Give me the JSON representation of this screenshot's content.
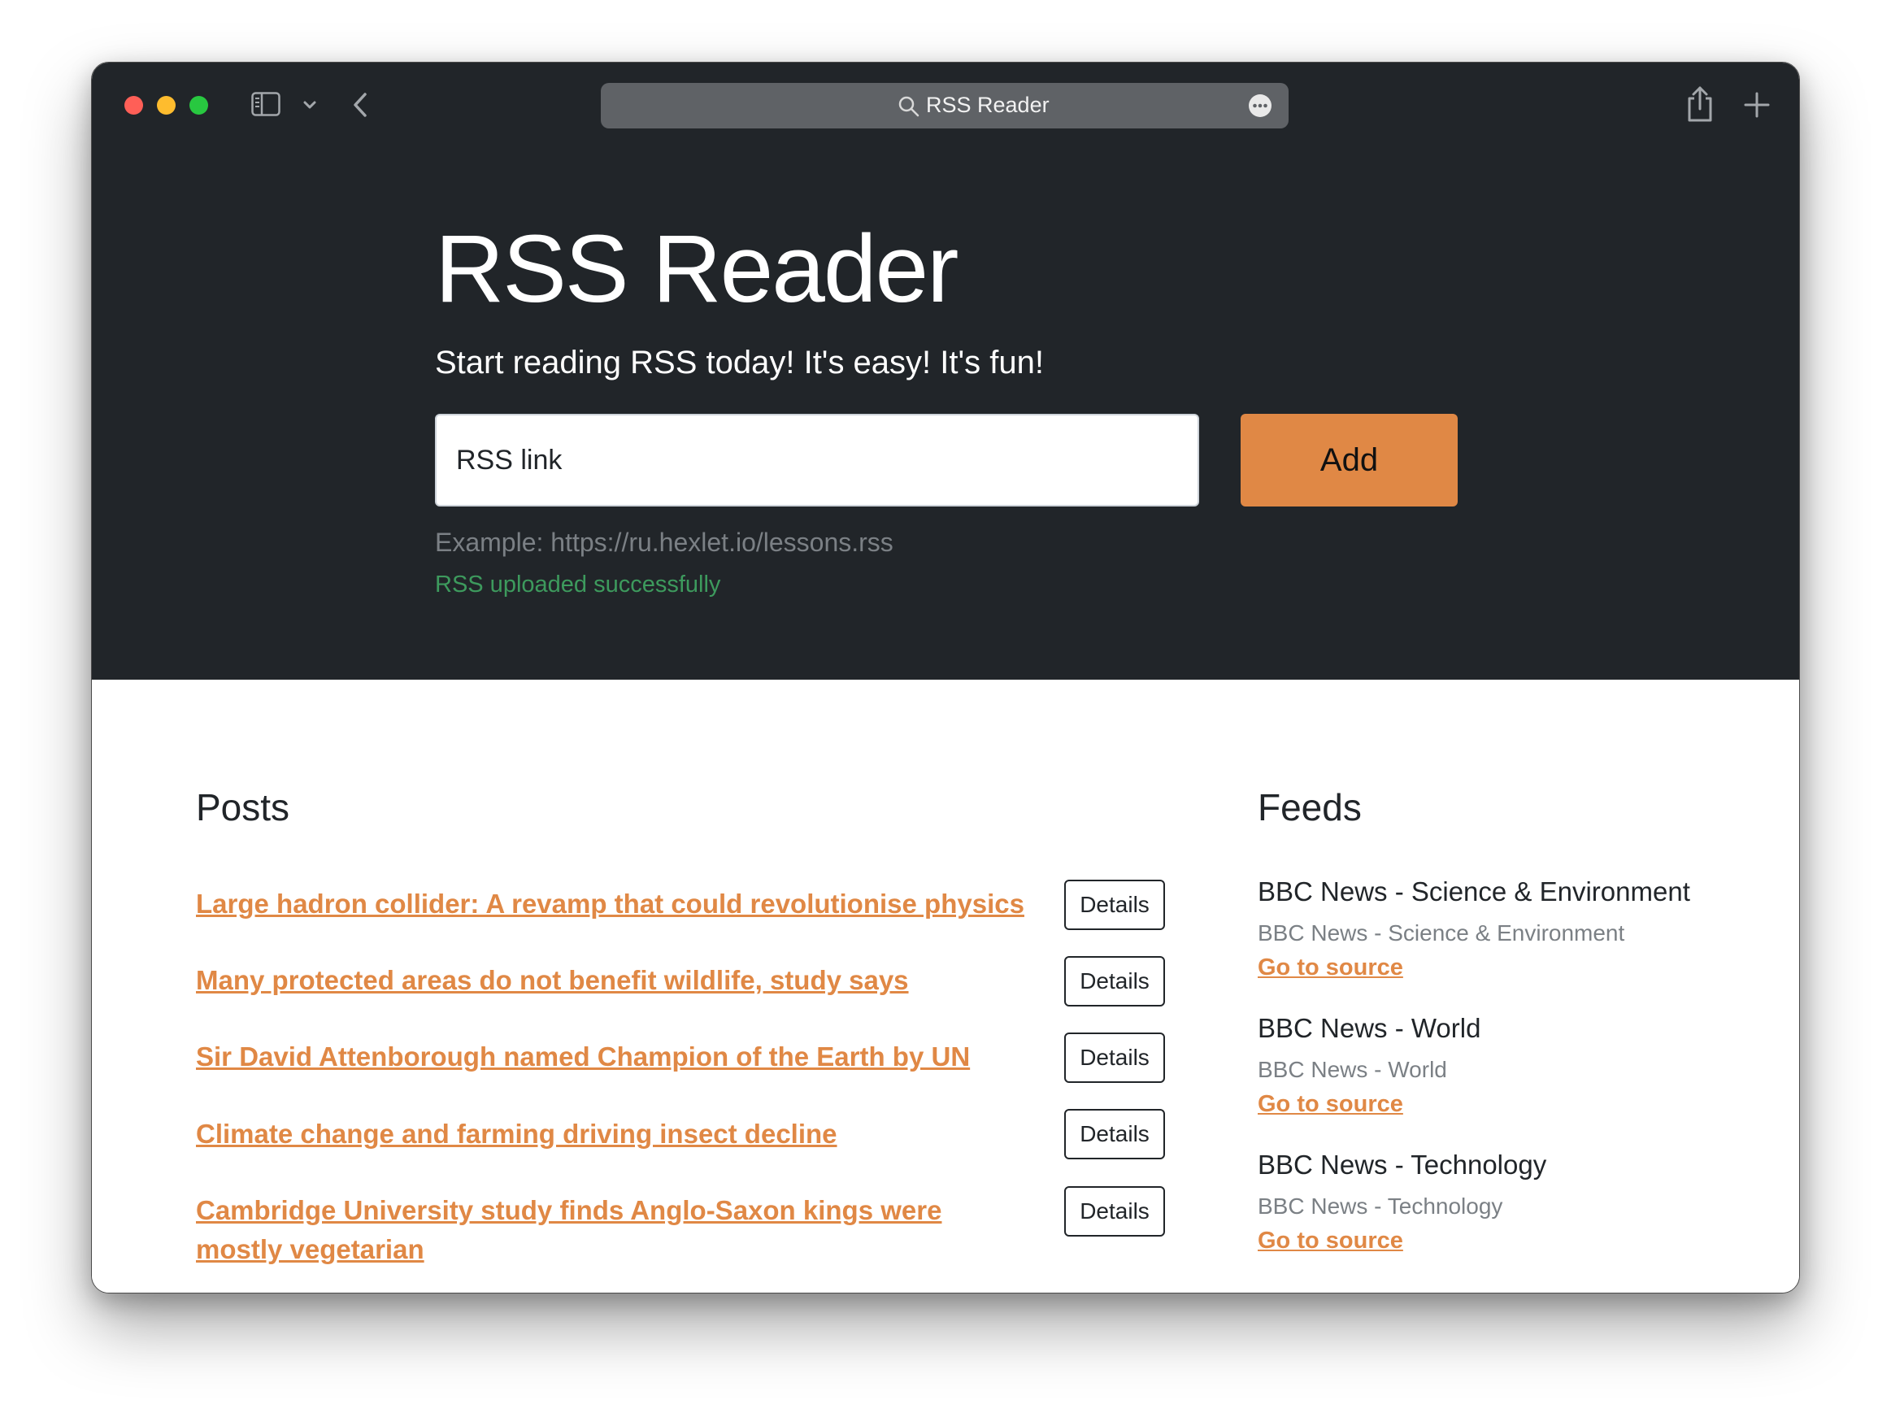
{
  "browser": {
    "address_text": "RSS Reader"
  },
  "hero": {
    "title": "RSS Reader",
    "lead": "Start reading RSS today! It's easy! It's fun!",
    "input_placeholder": "RSS link",
    "add_label": "Add",
    "example": "Example: https://ru.hexlet.io/lessons.rss",
    "feedback": "RSS uploaded successfully"
  },
  "posts": {
    "title": "Posts",
    "details_label": "Details",
    "items": [
      {
        "title": "Large hadron collider: A revamp that could revolutionise physics"
      },
      {
        "title": "Many protected areas do not benefit wildlife, study says"
      },
      {
        "title": "Sir David Attenborough named Champion of the Earth by UN"
      },
      {
        "title": "Climate change and farming driving insect decline"
      },
      {
        "title": "Cambridge University study finds Anglo-Saxon kings were mostly vegetarian"
      }
    ]
  },
  "feeds": {
    "title": "Feeds",
    "link_label": "Go to source",
    "items": [
      {
        "title": "BBC News - Science & Environment",
        "description": "BBC News - Science & Environment"
      },
      {
        "title": "BBC News - World",
        "description": "BBC News - World"
      },
      {
        "title": "BBC News - Technology",
        "description": "BBC News - Technology"
      }
    ]
  },
  "colors": {
    "accent": "#e08845",
    "dark": "#212529",
    "success": "#3d9a5d"
  }
}
